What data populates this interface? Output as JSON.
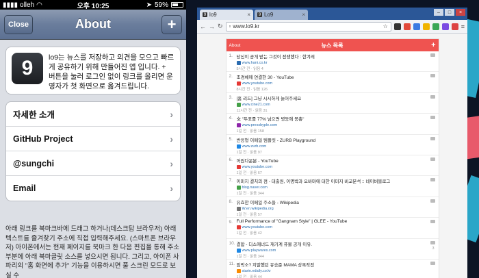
{
  "phone": {
    "status": {
      "carrier": "olleh",
      "time": "오후 10:25",
      "battery": "59%",
      "battery_level": 0.59
    },
    "nav": {
      "close_label": "Close",
      "title": "About",
      "plus_label": "+"
    },
    "logo_text": "9",
    "about_text": "lo9는 뉴스를 저장하고 의견을 모으고 빠르게 공유하기 위해 만들어진 앱 입니다. + 버튼을 눌러 로그인 없이 링크를 올리면 운영자가 첫 화면으로 옮겨드립니다.",
    "menu": [
      {
        "label": "자세한 소개"
      },
      {
        "label": "GitHub Project"
      },
      {
        "label": "@sungchi"
      },
      {
        "label": "Email"
      }
    ],
    "bottom_text": "아래 링크를 북마크바에 드래그 하거나(데스크탑 브라우저) 아래 텍스트를 즐겨찾기 주소에 직접 입력해주세요. (스마트폰 브라우저) 아이폰에서는 현재 페이지를 북마크 한 다음 편집을 통해 주소부분에 아래 북마클릿 소스를 넣으시면 됩니다. 그리고, 아이폰 사파리의 \"홈 화면에 추가\" 기능을 이용하시면 풀 스크린 모드로 보실 수"
  },
  "browser": {
    "tabs": [
      {
        "label": "lo9",
        "favicon": "9"
      },
      {
        "label": "Lo9",
        "favicon": "9"
      }
    ],
    "url": "www.lo9.kr",
    "extension_colors": [
      "#333333",
      "#e24a3b",
      "#3b7be2",
      "#f0b400",
      "#3aa757",
      "#7a4ae2",
      "#d44",
      "#2b5797"
    ],
    "site": {
      "about_label": "About",
      "title": "뉴스 목록",
      "plus_label": "+"
    },
    "news": [
      {
        "num": "1.",
        "title": "당신이 공개 받는 그것이 전쟁했다 : 한겨레",
        "url": "www.hani.co.kr",
        "meta": "5시간 전 · 읽음 4",
        "fav_color": "#2b6cb0",
        "comments": ""
      },
      {
        "num": "2.",
        "title": "조경체에 연결한 30 - YouTube",
        "url": "www.youtube.com",
        "meta": "8시간 전 · 읽음 126",
        "fav_color": "#e53935",
        "comments": ""
      },
      {
        "num": "3.",
        "title": "[홈 리드] 그냥 시시하게 늙어주세요",
        "url": "www.cine21.com",
        "meta": "11시간 전 · 읽음 31",
        "fav_color": "#43a047",
        "comments": ""
      },
      {
        "num": "4.",
        "title": "文 \"두표를 77% 넘으면 병동에 몽총\"",
        "url": "www.pressbyple.com",
        "meta": "1일 전 · 읽음 158",
        "fav_color": "#8e24aa",
        "comments": ""
      },
      {
        "num": "5.",
        "title": "반응형 이메일 템플릿 - ZURB Playground",
        "url": "www.zurb.com",
        "meta": "1일 전 · 읽음 97",
        "fav_color": "#1e88e5",
        "comments": ""
      },
      {
        "num": "6.",
        "title": "어원다운분 - YouTube",
        "url": "www.youtube.com",
        "meta": "1일 전 · 읽음 67",
        "fav_color": "#e53935",
        "comments": ""
      },
      {
        "num": "7.",
        "title": "이미지 결치의 점 - 대출원, 이명박과 오바마에 대한 이미지 비교분석 :: 네이버블로그",
        "url": "blog.naver.com",
        "meta": "1일 전 · 읽음 344",
        "fav_color": "#43a047",
        "comments": ""
      },
      {
        "num": "8.",
        "title": "유효한 이메일 주소들 - Wikipedia",
        "url": "W.en.wikipedia.org",
        "meta": "1일 전 · 읽음 57",
        "fav_color": "#757575",
        "comments": ""
      },
      {
        "num": "9.",
        "title": "Full Performance of \"Gangnam Style\" | GLEE - YouTube",
        "url": "www.youtube.com",
        "meta": "1일 전 · 읽음 42",
        "fav_color": "#e53935",
        "comments": ""
      },
      {
        "num": "10.",
        "title": "결합 - 디스에너드 재기계 퓨물 공개 이유.",
        "url": "www.playwares.com",
        "meta": "1일 전 · 읽음 344",
        "fav_color": "#1e88e5",
        "comments": "3"
      },
      {
        "num": "11.",
        "title": "암박소? 지말했던 유승준 MAMA 상록작전",
        "url": "starin.edaily.co.kr",
        "meta": "1일 전 · 읽음 44",
        "fav_color": "#fb8c00",
        "comments": ""
      }
    ]
  }
}
